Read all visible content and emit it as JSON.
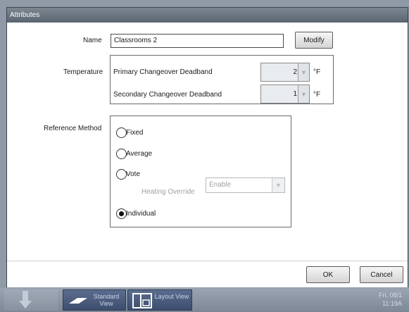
{
  "dialog": {
    "title": "Attributes",
    "name_label": "Name",
    "name_value": "Classrooms 2",
    "modify_label": "Modify",
    "temperature_label": "Temperature",
    "primary_label": "Primary Changeover Deadband",
    "primary_value": "2",
    "secondary_label": "Secondary Changeover Deadband",
    "secondary_value": "1",
    "unit": "°F",
    "reference_label": "Reference Method",
    "options": {
      "fixed": "Fixed",
      "average": "Average",
      "vote": "Vote",
      "individual": "Individual"
    },
    "selected_option": "Individual",
    "heating_override_label": "Heating Override",
    "heating_override_value": "Enable",
    "ok_label": "OK",
    "cancel_label": "Cancel"
  },
  "taskbar": {
    "standard_view": "Standard View",
    "layout_view": "Layout View",
    "date": "Fri, 08/1",
    "time": "11:19A"
  },
  "icons": {
    "arrow": "down-arrow-icon",
    "standard": "standard-view-icon",
    "layout": "layout-view-icon"
  }
}
